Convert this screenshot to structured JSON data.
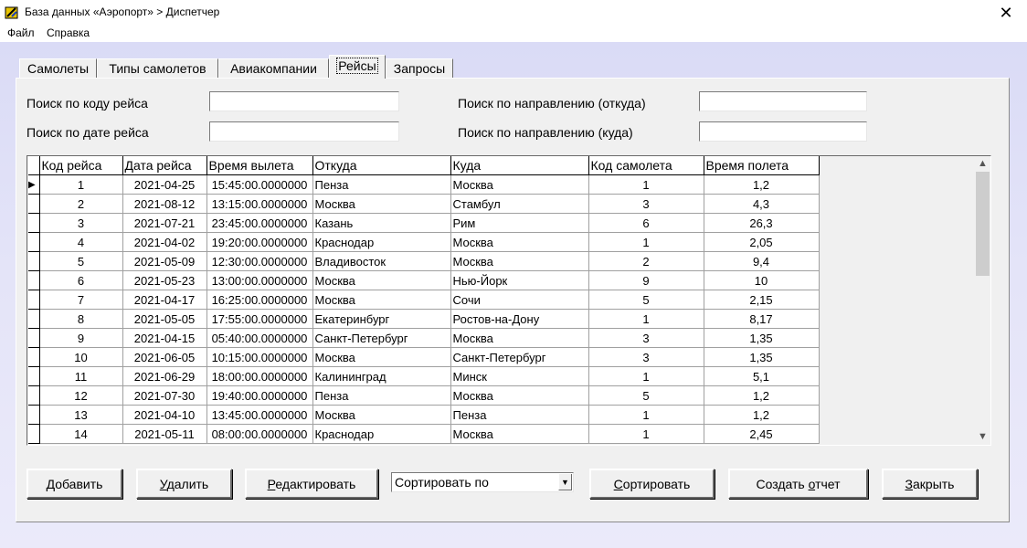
{
  "window": {
    "title": "База данных «Аэропорт» > Диспетчер",
    "close_glyph": "✕"
  },
  "menu": {
    "items": [
      "Файл",
      "Справка"
    ]
  },
  "tabs": [
    "Самолеты",
    "Типы самолетов",
    "Авиакомпании",
    "Рейсы",
    "Запросы"
  ],
  "active_tab": "Рейсы",
  "search": {
    "by_code_label": "Поиск по коду рейса",
    "by_date_label": "Поиск по дате рейса",
    "by_from_label": "Поиск по направлению (откуда)",
    "by_to_label": "Поиск по направлению (куда)",
    "by_code_value": "",
    "by_date_value": "",
    "by_from_value": "",
    "by_to_value": ""
  },
  "table": {
    "columns": [
      "Код рейса",
      "Дата рейса",
      "Время вылета",
      "Откуда",
      "Куда",
      "Код самолета",
      "Время полета"
    ],
    "rows": [
      [
        "1",
        "2021-04-25",
        "15:45:00.0000000",
        "Пенза",
        "Москва",
        "1",
        "1,2"
      ],
      [
        "2",
        "2021-08-12",
        "13:15:00.0000000",
        "Москва",
        "Стамбул",
        "3",
        "4,3"
      ],
      [
        "3",
        "2021-07-21",
        "23:45:00.0000000",
        "Казань",
        "Рим",
        "6",
        "26,3"
      ],
      [
        "4",
        "2021-04-02",
        "19:20:00.0000000",
        "Краснодар",
        "Москва",
        "1",
        "2,05"
      ],
      [
        "5",
        "2021-05-09",
        "12:30:00.0000000",
        "Владивосток",
        "Москва",
        "2",
        "9,4"
      ],
      [
        "6",
        "2021-05-23",
        "13:00:00.0000000",
        "Москва",
        "Нью-Йорк",
        "9",
        "10"
      ],
      [
        "7",
        "2021-04-17",
        "16:25:00.0000000",
        "Москва",
        "Сочи",
        "5",
        "2,15"
      ],
      [
        "8",
        "2021-05-05",
        "17:55:00.0000000",
        "Екатеринбург",
        "Ростов-на-Дону",
        "1",
        "8,17"
      ],
      [
        "9",
        "2021-04-15",
        "05:40:00.0000000",
        "Санкт-Петербург",
        "Москва",
        "3",
        "1,35"
      ],
      [
        "10",
        "2021-06-05",
        "10:15:00.0000000",
        "Москва",
        "Санкт-Петербург",
        "3",
        "1,35"
      ],
      [
        "11",
        "2021-06-29",
        "18:00:00.0000000",
        "Калининград",
        "Минск",
        "1",
        "5,1"
      ],
      [
        "12",
        "2021-07-30",
        "19:40:00.0000000",
        "Пенза",
        "Москва",
        "5",
        "1,2"
      ],
      [
        "13",
        "2021-04-10",
        "13:45:00.0000000",
        "Москва",
        "Пенза",
        "1",
        "1,2"
      ],
      [
        "14",
        "2021-05-11",
        "08:00:00.0000000",
        "Краснодар",
        "Москва",
        "1",
        "2,45"
      ]
    ],
    "current_row_indicator": "▶"
  },
  "buttons": {
    "add": {
      "mnemonic": "Д",
      "rest": "обавить"
    },
    "delete": {
      "mnemonic": "У",
      "rest": "далить"
    },
    "edit": {
      "mnemonic": "Р",
      "rest": "едактировать"
    },
    "sort": {
      "mnemonic": "С",
      "rest": "ортировать"
    },
    "report": {
      "pre": "Создать ",
      "mnemonic": "о",
      "rest": "тчет"
    },
    "close": {
      "mnemonic": "З",
      "rest": "акрыть"
    }
  },
  "sort_combo": {
    "value": "Сортировать по"
  },
  "scrollbar": {
    "up_glyph": "▲",
    "down_glyph": "▼",
    "position_fraction": 0.0
  }
}
